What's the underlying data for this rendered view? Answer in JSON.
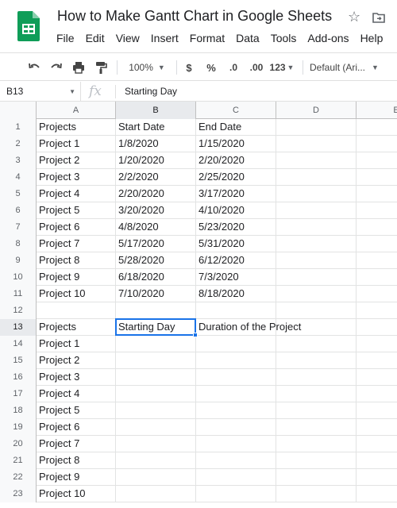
{
  "app": {
    "doc_title": "How to Make Gantt Chart in Google Sheets",
    "menu": [
      "File",
      "Edit",
      "View",
      "Insert",
      "Format",
      "Data",
      "Tools",
      "Add-ons",
      "Help"
    ]
  },
  "toolbar": {
    "zoom": "100%",
    "currency": "$",
    "percent": "%",
    "decrease_decimal": ".0",
    "increase_decimal": ".00",
    "more_formats": "123",
    "font": "Default (Ari..."
  },
  "formula_bar": {
    "cell_ref": "B13",
    "fx_label": "fx",
    "content": "Starting Day"
  },
  "sheet": {
    "columns": [
      "A",
      "B",
      "C",
      "D",
      "E"
    ],
    "selected_column": "B",
    "selected_cell": "B13",
    "rows": [
      {
        "n": "1",
        "a": "Projects",
        "b": "Start Date",
        "c": "End Date"
      },
      {
        "n": "2",
        "a": "Project 1",
        "b": "1/8/2020",
        "c": "1/15/2020"
      },
      {
        "n": "3",
        "a": "Project 2",
        "b": "1/20/2020",
        "c": "2/20/2020"
      },
      {
        "n": "4",
        "a": "Project 3",
        "b": "2/2/2020",
        "c": "2/25/2020"
      },
      {
        "n": "5",
        "a": "Project 4",
        "b": "2/20/2020",
        "c": "3/17/2020"
      },
      {
        "n": "6",
        "a": "Project 5",
        "b": "3/20/2020",
        "c": "4/10/2020"
      },
      {
        "n": "7",
        "a": "Project 6",
        "b": "4/8/2020",
        "c": "5/23/2020"
      },
      {
        "n": "8",
        "a": "Project 7",
        "b": "5/17/2020",
        "c": "5/31/2020"
      },
      {
        "n": "9",
        "a": "Project 8",
        "b": "5/28/2020",
        "c": "6/12/2020"
      },
      {
        "n": "10",
        "a": "Project 9",
        "b": "6/18/2020",
        "c": "7/3/2020"
      },
      {
        "n": "11",
        "a": "Project 10",
        "b": "7/10/2020",
        "c": "8/18/2020"
      },
      {
        "n": "12",
        "a": "",
        "b": "",
        "c": ""
      },
      {
        "n": "13",
        "a": "Projects",
        "b": "Starting Day",
        "c": "Duration of the Project"
      },
      {
        "n": "14",
        "a": "Project 1",
        "b": "",
        "c": ""
      },
      {
        "n": "15",
        "a": "Project 2",
        "b": "",
        "c": ""
      },
      {
        "n": "16",
        "a": "Project 3",
        "b": "",
        "c": ""
      },
      {
        "n": "17",
        "a": "Project 4",
        "b": "",
        "c": ""
      },
      {
        "n": "18",
        "a": "Project 5",
        "b": "",
        "c": ""
      },
      {
        "n": "19",
        "a": "Project 6",
        "b": "",
        "c": ""
      },
      {
        "n": "20",
        "a": "Project 7",
        "b": "",
        "c": ""
      },
      {
        "n": "21",
        "a": "Project 8",
        "b": "",
        "c": ""
      },
      {
        "n": "22",
        "a": "Project 9",
        "b": "",
        "c": ""
      },
      {
        "n": "23",
        "a": "Project 10",
        "b": "",
        "c": ""
      }
    ]
  },
  "colors": {
    "accent": "#1a73e8",
    "sheets_green": "#0f9d58",
    "header_bg": "#f8f9fa",
    "header_selected_bg": "#e8eaed"
  }
}
